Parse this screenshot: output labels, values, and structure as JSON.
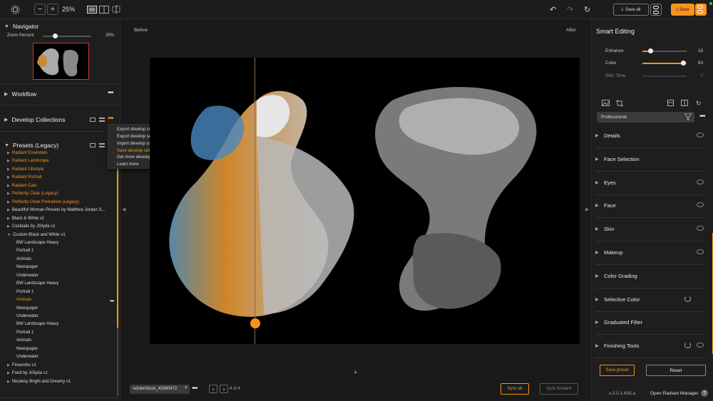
{
  "toolbar": {
    "zoom": "25%",
    "save_all": "Save all",
    "save": "Save"
  },
  "navigator": {
    "title": "Navigator",
    "zoom_label": "Zoom Percent",
    "zoom_value": "25%",
    "zoom_fraction": 0.25
  },
  "sections": {
    "workflow": "Workflow",
    "develop_collections": "Develop Collections",
    "presets": "Presets (Legacy)"
  },
  "context_menu": {
    "items": [
      "Export develop collection",
      "Export develop settings",
      "Import develop collection/settings",
      "Save develop settings",
      "Get more develop collections",
      "Learn more"
    ],
    "active_index": 3
  },
  "presets": [
    {
      "label": "Radiant Essentials",
      "level": 0,
      "orange": true
    },
    {
      "label": "Radiant Landscape",
      "level": 0,
      "orange": true
    },
    {
      "label": "Radiant Lifestyle",
      "level": 0,
      "orange": true
    },
    {
      "label": "Radiant Portrait",
      "level": 0,
      "orange": true
    },
    {
      "label": "Radiant Cats",
      "level": 0,
      "orange": true
    },
    {
      "label": "Perfectly Clear (Legacy)",
      "level": 0,
      "orange": true
    },
    {
      "label": "Perfectly Clear Portraiture (Legacy)",
      "level": 0,
      "orange": true
    },
    {
      "label": "Beautiful Woman Presets by Matthew Jordan S...",
      "level": 0,
      "orange": false
    },
    {
      "label": "Black & White v1",
      "level": 0,
      "orange": false
    },
    {
      "label": "Cocktails by JGlyda v1",
      "level": 0,
      "orange": false
    },
    {
      "label": "Custom Black and White v1",
      "level": 0,
      "orange": false,
      "open": true
    },
    {
      "label": "BW Landscape Heavy",
      "level": 1,
      "orange": false
    },
    {
      "label": "Portrait 1",
      "level": 1,
      "orange": false
    },
    {
      "label": "Animals",
      "level": 1,
      "orange": false
    },
    {
      "label": "Newspaper",
      "level": 1,
      "orange": false
    },
    {
      "label": "Underwater",
      "level": 1,
      "orange": false
    },
    {
      "label": "BW Landscape Heavy",
      "level": 1,
      "orange": false
    },
    {
      "label": "Portrait 1",
      "level": 1,
      "orange": false
    },
    {
      "label": "Animals",
      "level": 1,
      "orange": true
    },
    {
      "label": "Newspaper",
      "level": 1,
      "orange": false
    },
    {
      "label": "Underwater",
      "level": 1,
      "orange": false
    },
    {
      "label": "BW Landscape Heavy",
      "level": 1,
      "orange": false
    },
    {
      "label": "Portrait 1",
      "level": 1,
      "orange": false
    },
    {
      "label": "Animals",
      "level": 1,
      "orange": false
    },
    {
      "label": "Newspaper",
      "level": 1,
      "orange": false
    },
    {
      "label": "Underwater",
      "level": 1,
      "orange": false
    },
    {
      "label": "Fireworks v1",
      "level": 0,
      "orange": false
    },
    {
      "label": "Food by JGlyda v1",
      "level": 0,
      "orange": false
    },
    {
      "label": "Nicolesy Bright and Dreamy v1",
      "level": 0,
      "orange": false
    }
  ],
  "center": {
    "before": "Before",
    "after": "After",
    "file_name": "AdobeStock_42860472",
    "page": "4 of 4",
    "sync_all": "Sync all",
    "sync_forward": "Sync forward"
  },
  "smart_editing": {
    "title": "Smart Editing",
    "sliders": [
      {
        "label": "Enhance",
        "value": "18",
        "fraction": 0.18
      },
      {
        "label": "Color",
        "value": "93",
        "fraction": 0.93
      },
      {
        "label": "Skin Tone",
        "value": "0",
        "fraction": 0
      }
    ],
    "profile": "Professional"
  },
  "categories": [
    {
      "label": "Details",
      "reset": false
    },
    {
      "label": "Face Selection",
      "reset": false,
      "noeye": true
    },
    {
      "label": "Eyes",
      "reset": false
    },
    {
      "label": "Face",
      "reset": false
    },
    {
      "label": "Skin",
      "reset": false
    },
    {
      "label": "Makeup",
      "reset": false
    },
    {
      "label": "Color Grading",
      "reset": false,
      "noeye": true
    },
    {
      "label": "Selective Color",
      "reset": true,
      "noeye": true
    },
    {
      "label": "Graduated Filter",
      "reset": false,
      "noeye": true
    },
    {
      "label": "Finishing Tools",
      "reset": true
    }
  ],
  "footer": {
    "save_preset": "Save preset",
    "reset": "Reset",
    "version": "v.2.0.1.605.a",
    "open_rm": "Open Radiant Manager",
    "help": "?"
  },
  "colors": {
    "accent": "#f7931e",
    "bg": "#1a1a1a",
    "panel": "#1e1e1e"
  }
}
